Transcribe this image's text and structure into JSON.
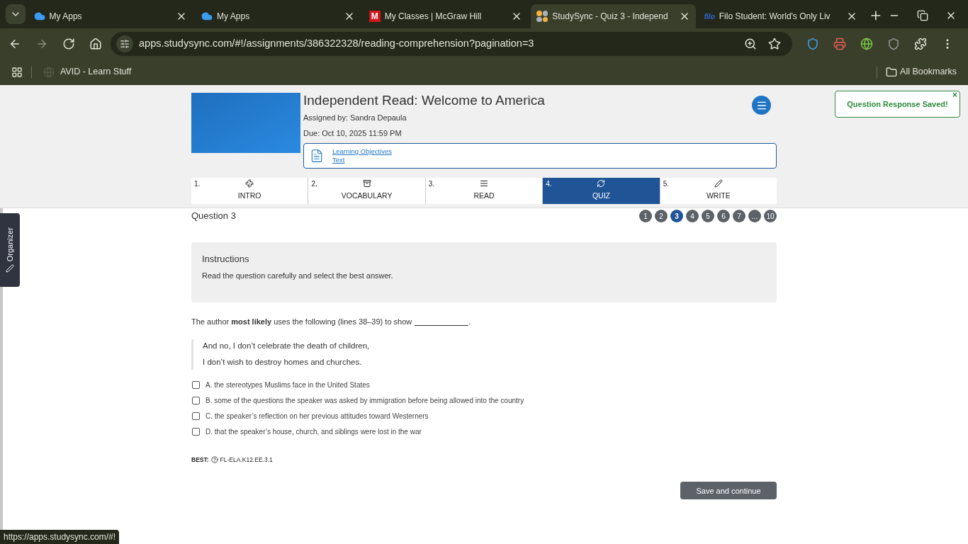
{
  "browser": {
    "tabs": [
      {
        "title": "My Apps",
        "kind": "cloud",
        "selected": false
      },
      {
        "title": "My Apps",
        "kind": "cloud",
        "selected": false
      },
      {
        "title": "My Classes | McGraw Hill",
        "kind": "letter",
        "icon_text": "M",
        "selected": false
      },
      {
        "title": "StudySync - Quiz 3 - Independ",
        "kind": "dots",
        "selected": true
      },
      {
        "title": "Filo Student: World's Only Liv",
        "kind": "wordmark",
        "icon_text": "filo",
        "selected": false
      }
    ],
    "url": "apps.studysync.com/#!/assignments/386322328/reading-comprehension?pagination=3",
    "bookmarks": [
      {
        "label": "AVID - Learn Stuff"
      }
    ],
    "all_bookmarks": "All Bookmarks",
    "status_url": "https://apps.studysync.com/#!"
  },
  "assignment": {
    "title": "Independent Read: Welcome to America",
    "assigned_by": "Assigned by: Sandra Depaula",
    "due": "Due: Oct 10, 2025 11:59 PM",
    "links": [
      "Learning Objectives",
      "Text"
    ]
  },
  "toast": {
    "message": "Question Response Saved!",
    "close": "×"
  },
  "organizer": {
    "label": "Organizer"
  },
  "steps": [
    {
      "number": "1.",
      "label": "INTRO",
      "kind": "fan",
      "selected": false
    },
    {
      "number": "2.",
      "label": "VOCABULARY",
      "kind": "box",
      "selected": false
    },
    {
      "number": "3.",
      "label": "READ",
      "kind": "lines",
      "selected": false
    },
    {
      "number": "4.",
      "label": "QUIZ",
      "kind": "refresh",
      "selected": true
    },
    {
      "number": "5.",
      "label": "WRITE",
      "kind": "pencil",
      "selected": false
    }
  ],
  "question": {
    "title": "Question 3",
    "pages": [
      {
        "label": "1",
        "selected": false
      },
      {
        "label": "2",
        "selected": false
      },
      {
        "label": "3",
        "selected": true
      },
      {
        "label": "4",
        "selected": false
      },
      {
        "label": "5",
        "selected": false
      },
      {
        "label": "6",
        "selected": false
      },
      {
        "label": "7",
        "selected": false
      },
      {
        "label": "...",
        "selected": false
      },
      {
        "label": "10",
        "selected": false
      }
    ],
    "instructions_title": "Instructions",
    "instructions": "Read the question carefully and select the best answer.",
    "prompt": "The author **most likely** uses the following (lines 38–39) to show",
    "prompt_end": ".",
    "quote": [
      "And no, I don’t celebrate the death of children,",
      "I don’t wish to destroy homes and churches."
    ],
    "options": [
      {
        "text": "A. the stereotypes Muslims face in the United States",
        "checked": false
      },
      {
        "text": "B. some of the questions the speaker was asked by immigration before being allowed into the country",
        "checked": false
      },
      {
        "text": "C. the speaker’s reflection on her previous attitudes toward Westerners",
        "checked": false
      },
      {
        "text": "D. that the speaker’s house, church, and siblings were lost in the war",
        "checked": false
      }
    ],
    "standard_label": "BEST:",
    "standard": "FL-ELA.K12.EE.3.1",
    "save_button": "Save and continue"
  }
}
